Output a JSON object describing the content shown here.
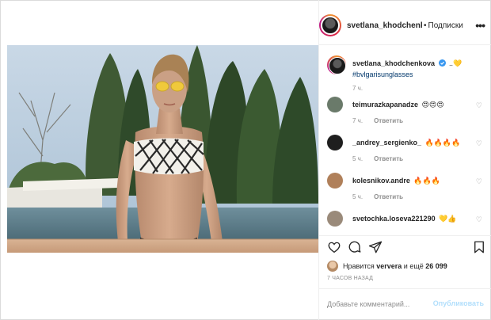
{
  "header": {
    "username": "svetlana_khodchenkov",
    "separator": "•",
    "follow_label": "Подписки",
    "more_glyph": "•••"
  },
  "caption": {
    "username": "svetlana_khodchenkova",
    "text": "..💛",
    "hashtag": "#bvlgarisunglasses",
    "time": "7 ч."
  },
  "comments": [
    {
      "username": "teimurazkapanadze",
      "text": "😍😍😍",
      "time": "7 ч.",
      "reply_label": "Ответить",
      "avatar_color": "#6a7a6a"
    },
    {
      "username": "_andrey_sergienko_",
      "text": "🔥🔥🔥🔥",
      "time": "5 ч.",
      "reply_label": "Ответить",
      "avatar_color": "#1e1e1e"
    },
    {
      "username": "kolesnikov.andre",
      "text": "🔥🔥🔥",
      "time": "5 ч.",
      "reply_label": "Ответить",
      "avatar_color": "#b0805a"
    },
    {
      "username": "svetochka.loseva221290",
      "text": "💛👍",
      "time": "",
      "reply_label": "",
      "avatar_color": "#9a8a7a"
    }
  ],
  "likes": {
    "prefix": "Нравится",
    "user": "ververa",
    "suffix": "и ещё",
    "count": "26 099"
  },
  "timestamp": "7 ЧАСОВ НАЗАД",
  "comment_input": {
    "placeholder": "Добавьте комментарий...",
    "post_label": "Опубликовать"
  },
  "icons": {
    "like": "heart-outline-icon",
    "comment": "comment-bubble-icon",
    "share": "paper-plane-icon",
    "save": "bookmark-icon"
  },
  "colors": {
    "link": "#00376b",
    "muted": "#8e8e8e",
    "post_disabled": "#b2dffc",
    "verified": "#3897f0"
  }
}
